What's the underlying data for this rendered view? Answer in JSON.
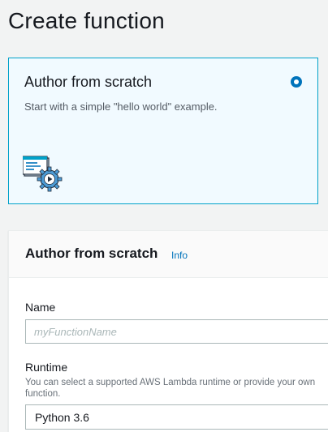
{
  "header": {
    "title": "Create function"
  },
  "option_card": {
    "title": "Author from scratch",
    "description": "Start with a simple \"hello world\" example.",
    "selected": true,
    "icon": "author-from-scratch-icon"
  },
  "panel": {
    "title": "Author from scratch",
    "info_link": "Info",
    "name": {
      "label": "Name",
      "placeholder": "myFunctionName",
      "value": ""
    },
    "runtime": {
      "label": "Runtime",
      "help_line_1": "You can select a supported AWS Lambda runtime or provide your own",
      "help_line_2": "function.",
      "selected": "Python 3.6"
    }
  },
  "colors": {
    "accent": "#0073bb",
    "selected_card_bg": "#f1faff",
    "selected_card_border": "#00a1c9"
  }
}
